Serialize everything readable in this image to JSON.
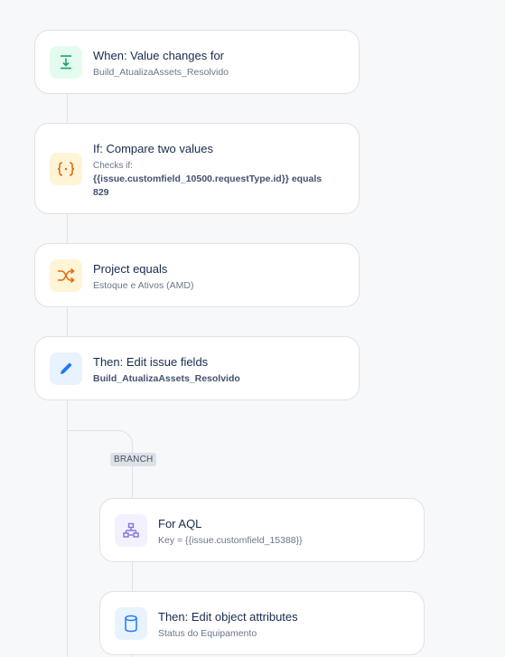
{
  "rules": [
    {
      "title": "When: Value changes for",
      "subtitle": "Build_AtualizaAssets_Resolvido",
      "icon": "download-trigger-icon",
      "color": "#e3fcef"
    },
    {
      "title": "If: Compare two values",
      "subtitle_lines": [
        "Checks if:",
        "{{issue.customfield_10500.requestType.id}} equals",
        "829"
      ],
      "icon": "braces-icon",
      "color": "#fff4d6"
    },
    {
      "title": "Project equals",
      "subtitle": "Estoque e Ativos (AMD)",
      "icon": "shuffle-icon",
      "color": "#fff4d6"
    },
    {
      "title": "Then: Edit issue fields",
      "subtitle": "Build_AtualizaAssets_Resolvido",
      "icon": "pencil-icon",
      "color": "#e9f2ff"
    }
  ],
  "branch": {
    "label": "BRANCH",
    "items": [
      {
        "title": "For AQL",
        "subtitle": "Key = {{issue.customfield_15388}}",
        "icon": "hierarchy-icon",
        "color": "#f3f0ff"
      },
      {
        "title": "Then: Edit object attributes",
        "subtitle": "Status do Equipamento",
        "icon": "database-icon",
        "color": "#e9f2ff"
      }
    ]
  }
}
